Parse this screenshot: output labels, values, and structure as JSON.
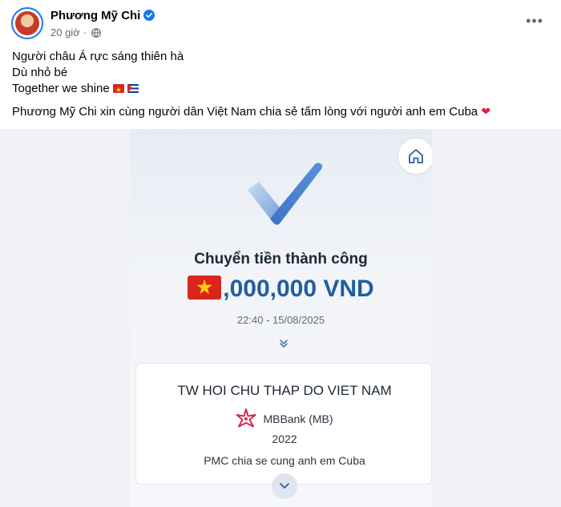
{
  "post": {
    "author": "Phương Mỹ Chi",
    "time": "20 giờ",
    "separator": "·",
    "lines": [
      "Người châu Á rực sáng thiên hà",
      "Dù nhỏ bé",
      "Together we shine"
    ],
    "message": "Phương Mỹ Chi xin cùng người dân Việt Nam chia sẻ tấm lòng với người anh em Cuba"
  },
  "receipt": {
    "status": "Chuyển tiền thành công",
    "amount": ",000,000 VND",
    "datetime": "22:40 - 15/08/2025",
    "recipient": "TW HOI CHU THAP DO VIET NAM",
    "bank": "MBBank (MB)",
    "account": "2022",
    "memo": "PMC chia se cung anh em Cuba"
  },
  "icons": {
    "verified": "verified-badge-icon",
    "globe": "globe-icon",
    "more": "more-options-icon",
    "home": "home-icon",
    "expand": "chevron-down-icon"
  },
  "colors": {
    "accent": "#1877f2",
    "amount": "#1f5ea0",
    "heart": "#e41e3f"
  }
}
